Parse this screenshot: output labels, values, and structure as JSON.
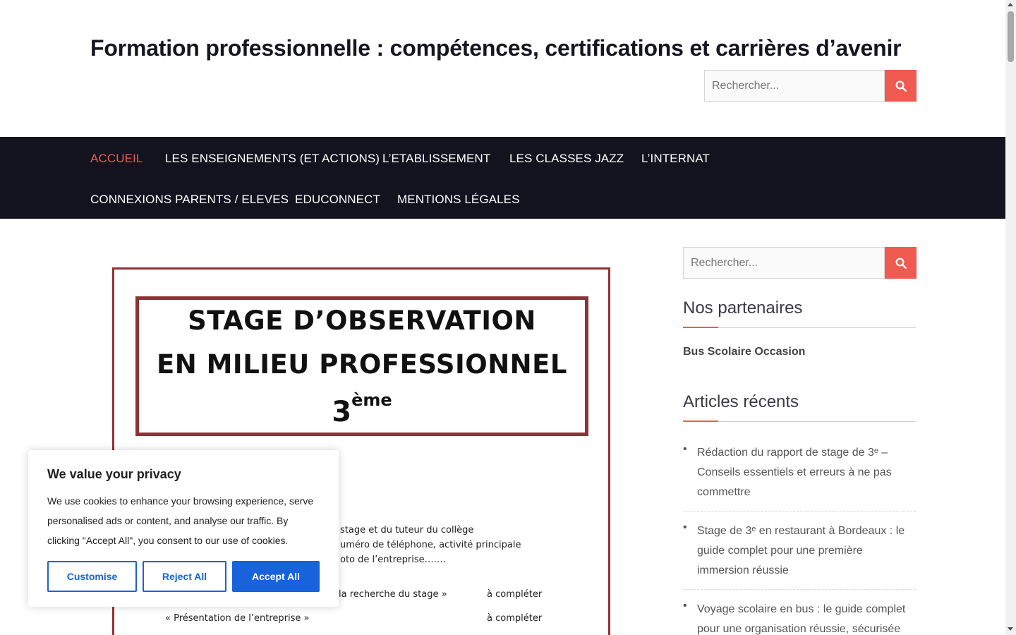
{
  "site": {
    "title": "Formation professionnelle : compétences, certifications et carrières d’avenir"
  },
  "header_search": {
    "placeholder": "Rechercher..."
  },
  "nav": {
    "items": [
      {
        "label": "Accueil",
        "active": true
      },
      {
        "label": "Les enseignements (et actions)"
      },
      {
        "label": "L’Etablissement"
      },
      {
        "label": "Les classes Jazz"
      },
      {
        "label": "L’internat"
      },
      {
        "label": "Connexions parents / eleves"
      },
      {
        "label": "Educonnect"
      },
      {
        "label": "Mentions légales"
      }
    ]
  },
  "featured_image": {
    "line1": "STAGE D’OBSERVATION",
    "line2": "EN MILIEU PROFESSIONNEL",
    "line3_base": "3",
    "line3_sup": "ème",
    "body_lines": [
      "stage et du tuteur du collège",
      "uméro de téléphone, activité principale",
      "oto de l’entreprise…….",
      "la recherche du stage »",
      "« Présentation de l’entreprise »"
    ],
    "todo_1": "à compléter",
    "todo_2": "à compléter"
  },
  "sidebar": {
    "search_placeholder": "Rechercher...",
    "partners_title": "Nos partenaires",
    "partner_link": "Bus Scolaire Occasion",
    "recent_title": "Articles récents",
    "recent_posts": [
      "Rédaction du rapport de stage de 3ᵉ – Conseils essentiels et erreurs à ne pas commettre",
      "Stage de 3ᵉ en restaurant à Bordeaux : le guide complet pour une première immersion réussie",
      "Voyage scolaire en bus : le guide complet pour une organisation réussie, sécurisée"
    ]
  },
  "cookie": {
    "title": "We value your privacy",
    "text": "We use cookies to enhance your browsing experience, serve personalised ads or content, and analyse our traffic. By clicking \"Accept All\", you consent to our use of cookies.",
    "customise": "Customise",
    "reject": "Reject All",
    "accept": "Accept All"
  },
  "colors": {
    "accent": "#f15a50",
    "nav_bg": "#13121f",
    "doc_border": "#8e3236",
    "cookie_button": "#1863dc"
  }
}
